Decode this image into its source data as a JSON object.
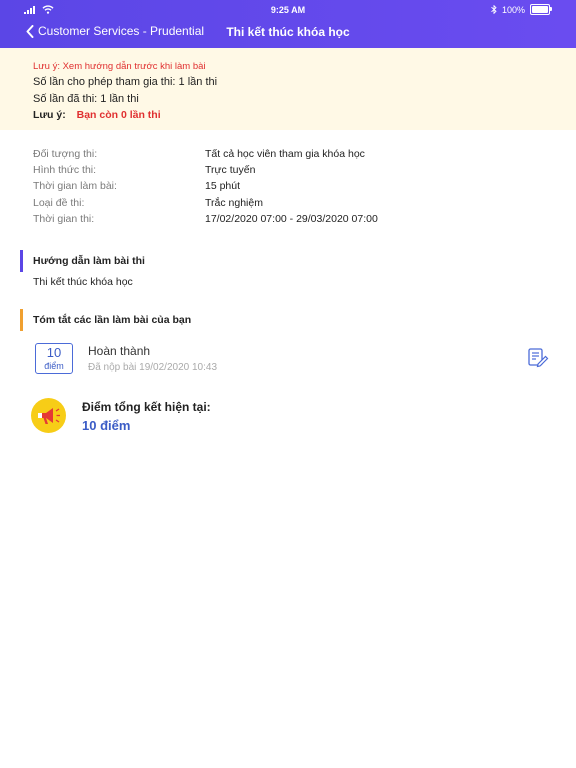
{
  "status_bar": {
    "time": "9:25 AM",
    "battery": "100%"
  },
  "nav": {
    "back_label": "Customer Services - Prudential",
    "title": "Thi kết thúc khóa học"
  },
  "notice": {
    "warning": "Lưu ý: Xem hướng dẫn trước khi làm bài",
    "allowed": "Số lần cho phép tham gia thi: 1 lần thi",
    "taken": "Số lần đã thi: 1 lần thi",
    "remaining_label": "Lưu ý:",
    "remaining_value": "Bạn còn 0 lần thi"
  },
  "exam_info": [
    {
      "label": "Đối tượng thi:",
      "value": "Tất cả học viên tham gia khóa học"
    },
    {
      "label": "Hình thức thi:",
      "value": "Trực tuyến"
    },
    {
      "label": "Thời gian làm bài:",
      "value": "15 phút"
    },
    {
      "label": "Loại đề thi:",
      "value": "Trắc nghiệm"
    },
    {
      "label": "Thời gian thi:",
      "value": "17/02/2020 07:00 - 29/03/2020 07:00"
    }
  ],
  "guide": {
    "title": "Hướng dẫn làm bài thi",
    "text": "Thi kết thúc khóa học"
  },
  "summary": {
    "title": "Tóm tắt các lần làm bài của bạn",
    "attempt": {
      "score": "10",
      "score_unit": "điểm",
      "status": "Hoàn thành",
      "submitted": "Đã nộp bài 19/02/2020 10:43"
    },
    "total_label": "Điểm tổng kết hiện tại:",
    "total_value": "10 điểm"
  },
  "colors": {
    "header": "#5b46e6",
    "notice_bg": "#fff9e6",
    "warning_red": "#e03030",
    "accent_blue": "#3b5cc6",
    "accent_orange": "#f0a030",
    "megaphone_yellow": "#f7cd17"
  },
  "icons": [
    "signal-icon",
    "wifi-icon",
    "bluetooth-icon",
    "battery-icon",
    "chevron-left-icon",
    "edit-document-icon",
    "megaphone-icon"
  ]
}
